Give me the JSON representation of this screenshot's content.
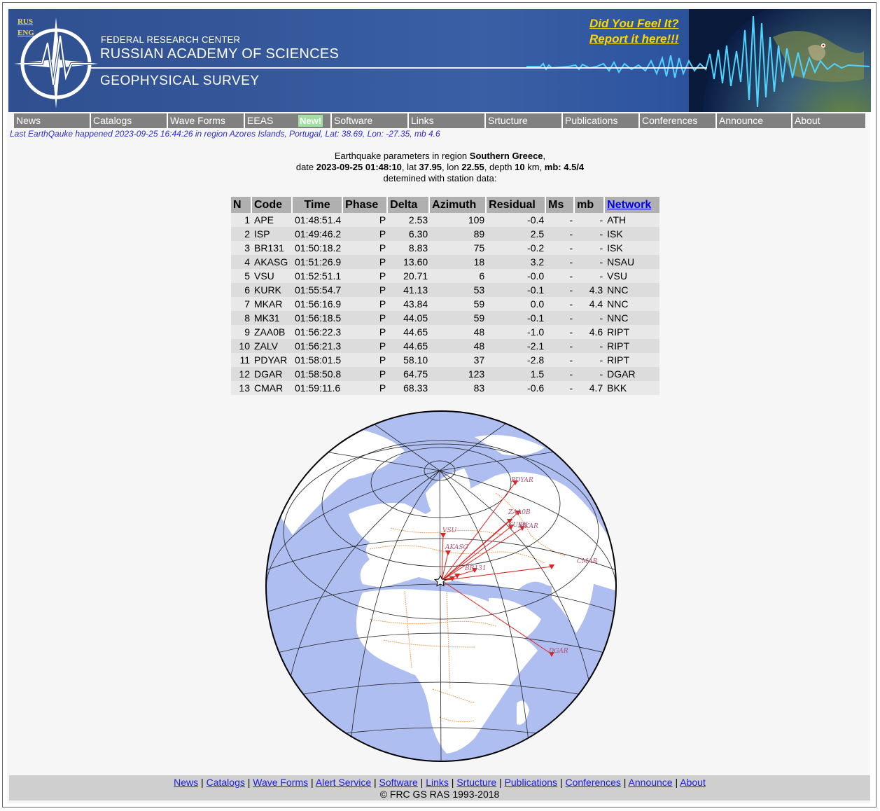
{
  "header": {
    "lang_rus": "RUS",
    "lang_eng": "ENG",
    "org_line1": "FEDERAL RESEARCH CENTER",
    "org_line2": "RUSSIAN ACADEMY OF SCIENCES",
    "org_line3": "GEOPHYSICAL SURVEY",
    "feel_line1": "Did You Feel It?",
    "feel_line2": "Report it here!!!"
  },
  "nav": {
    "items": [
      "News",
      "Catalogs",
      "Wave Forms",
      "EEAS",
      "Software",
      "Links",
      "Srtucture",
      "Publications",
      "Conferences",
      "Announce",
      "About"
    ],
    "new_badge": "New!"
  },
  "last_quake": "Last EarthQauke happened 2023-09-25 16:44:26 in region Azores Islands, Portugal, Lat: 38.69, Lon: -27.35, mb 4.6",
  "params": {
    "line1_prefix": "Earthquake parameters in region ",
    "region": "Southern Greece",
    "line1_suffix": ",",
    "date_label": "date ",
    "date": "2023-09-25 01:48:10",
    "lat_label": ", lat ",
    "lat": "37.95",
    "lon_label": ", lon ",
    "lon": "22.55",
    "depth_label": ", depth ",
    "depth": "10",
    "depth_unit": " km, ",
    "mb_label": "mb: 4.5/4",
    "line3": "detemined with station data:"
  },
  "table": {
    "headers": [
      "N",
      "Code",
      "Time",
      "Phase",
      "Delta",
      "Azimuth",
      "Residual",
      "Ms",
      "mb",
      "Network"
    ],
    "rows": [
      [
        "1",
        "APE",
        "01:48:51.4",
        "P",
        "2.53",
        "109",
        "-0.4",
        "-",
        "-",
        "ATH"
      ],
      [
        "2",
        "ISP",
        "01:49:46.2",
        "P",
        "6.30",
        "89",
        "2.5",
        "-",
        "-",
        "ISK"
      ],
      [
        "3",
        "BR131",
        "01:50:18.2",
        "P",
        "8.83",
        "75",
        "-0.2",
        "-",
        "-",
        "ISK"
      ],
      [
        "4",
        "AKASG",
        "01:51:26.9",
        "P",
        "13.60",
        "18",
        "3.2",
        "-",
        "-",
        "NSAU"
      ],
      [
        "5",
        "VSU",
        "01:52:51.1",
        "P",
        "20.71",
        "6",
        "-0.0",
        "-",
        "-",
        "VSU"
      ],
      [
        "6",
        "KURK",
        "01:55:54.7",
        "P",
        "41.13",
        "53",
        "-0.1",
        "-",
        "4.3",
        "NNC"
      ],
      [
        "7",
        "MKAR",
        "01:56:16.9",
        "P",
        "43.84",
        "59",
        "0.0",
        "-",
        "4.4",
        "NNC"
      ],
      [
        "8",
        "MK31",
        "01:56:18.5",
        "P",
        "44.05",
        "59",
        "-0.1",
        "-",
        "-",
        "NNC"
      ],
      [
        "9",
        "ZAA0B",
        "01:56:22.3",
        "P",
        "44.65",
        "48",
        "-1.0",
        "-",
        "4.6",
        "RIPT"
      ],
      [
        "10",
        "ZALV",
        "01:56:21.3",
        "P",
        "44.65",
        "48",
        "-2.1",
        "-",
        "-",
        "RIPT"
      ],
      [
        "11",
        "PDYAR",
        "01:58:01.5",
        "P",
        "58.10",
        "37",
        "-2.8",
        "-",
        "-",
        "RIPT"
      ],
      [
        "12",
        "DGAR",
        "01:58:50.8",
        "P",
        "64.75",
        "123",
        "1.5",
        "-",
        "-",
        "DGAR"
      ],
      [
        "13",
        "CMAR",
        "01:59:11.6",
        "P",
        "68.33",
        "83",
        "-0.6",
        "-",
        "4.7",
        "BKK"
      ]
    ]
  },
  "map": {
    "station_labels": [
      "PDYAR",
      "ZAA0B",
      "KURK",
      "MKAR",
      "VSU",
      "AKASG",
      "BR131",
      "CMAR",
      "DGAR"
    ],
    "colors": {
      "ocean": "#aebef0",
      "land": "#ffffff",
      "border": "#e8a060",
      "ray": "#dd2222",
      "label": "#b05070"
    }
  },
  "footer": {
    "links": [
      "News",
      "Catalogs",
      "Wave Forms",
      "Alert Service",
      "Software",
      "Links",
      "Srtucture",
      "Publications",
      "Conferences",
      "Announce",
      "About"
    ],
    "copyright": "© FRC GS RAS 1993-2018"
  }
}
